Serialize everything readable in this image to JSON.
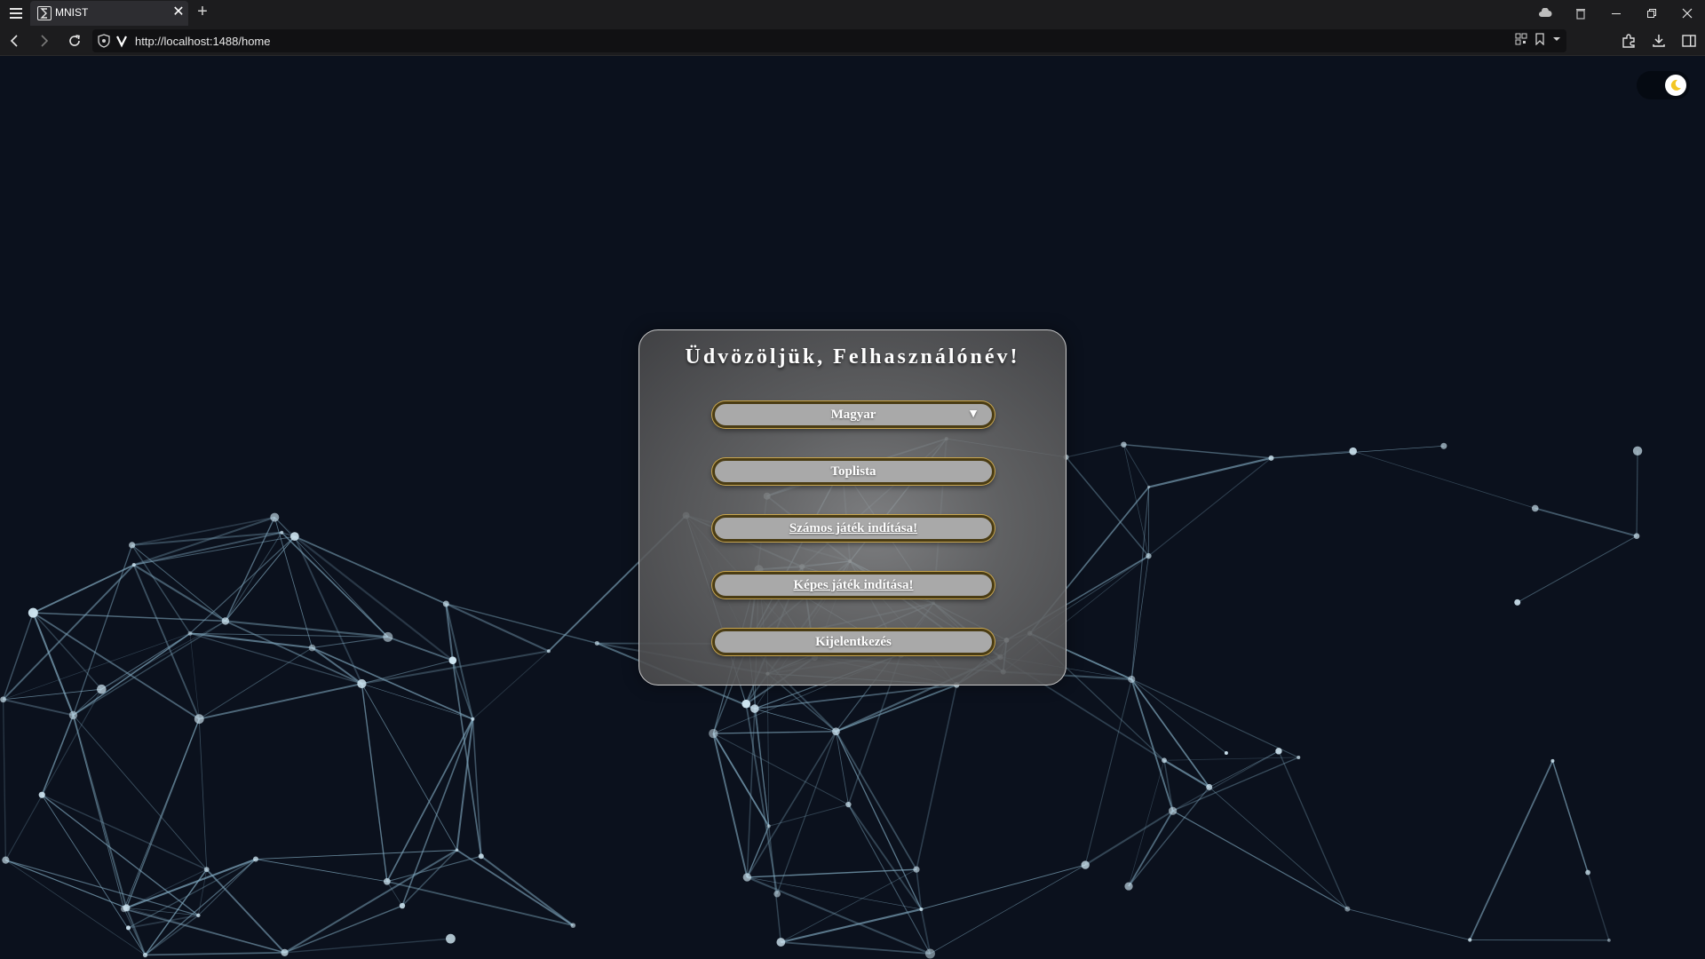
{
  "browser": {
    "tab_title": "MNIST",
    "tab_close": "✕",
    "new_tab": "+",
    "url": "http://localhost:1488/home"
  },
  "page": {
    "welcome": "Üdvözöljük, Felhasználónév!",
    "language_select": {
      "selected": "Magyar"
    },
    "buttons": {
      "toplist": "Toplista",
      "number_game": "Számos játék indítása!",
      "image_game": "Képes játék indítása!",
      "logout": "Kijelentkezés"
    },
    "theme_toggle": {
      "state": "dark",
      "icon": "moon-icon"
    }
  },
  "colors": {
    "background": "#0b111d",
    "network_lines": "#7fa7bd",
    "button_fill": "#a9a9a9",
    "button_border": "#4a3c14"
  }
}
